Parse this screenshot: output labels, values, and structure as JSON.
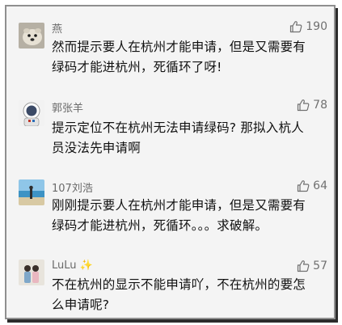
{
  "comments": [
    {
      "username": "燕",
      "likes": "190",
      "lines": [
        "然而提示要人在杭州才能申请，但是又需要有",
        "绿码才能进杭州，死循环了呀!"
      ],
      "avatar": "sea-otter-avatar"
    },
    {
      "username": "郭张羊",
      "likes": "78",
      "lines": [
        "提示定位不在杭州无法申请绿码? 那拟入杭人",
        "员没法先申请啊"
      ],
      "avatar": "astronaut-avatar"
    },
    {
      "username": "107刘浩",
      "likes": "64",
      "lines": [
        "刚刚提示要人在杭州才能申请，但是又需要有",
        "绿码才能进杭州，死循环。。。求破解。"
      ],
      "avatar": "seaside-avatar"
    },
    {
      "username": "LuLu",
      "username_badge": "✨",
      "likes": "57",
      "lines": [
        "不在杭州的显示不能申请吖，不在杭州的要怎",
        "么申请呢?"
      ],
      "avatar": "two-girls-avatar"
    }
  ],
  "colors": {
    "background": "#f4f4f4",
    "frame_border": "#8f8f8f",
    "shadow": "#2b2b2b",
    "username": "#6a6a6a",
    "text": "#111111",
    "like_icon": "#707070"
  },
  "icons": {
    "like": "thumbs-up-icon"
  }
}
